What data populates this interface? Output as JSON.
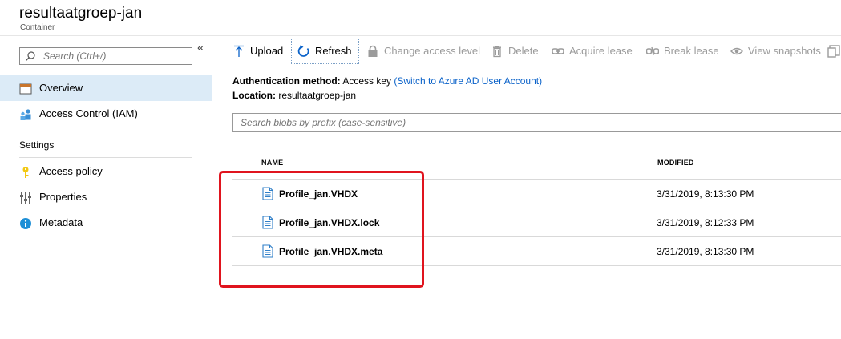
{
  "header": {
    "title": "resultaatgroep-jan",
    "subtitle": "Container"
  },
  "sidebar": {
    "search_placeholder": "Search (Ctrl+/)",
    "collapse_glyph": "«",
    "items": [
      {
        "label": "Overview",
        "icon": "container-overview-icon",
        "active": true
      },
      {
        "label": "Access Control (IAM)",
        "icon": "people-icon",
        "active": false
      }
    ],
    "settings_label": "Settings",
    "settings_items": [
      {
        "label": "Access policy",
        "icon": "key-icon"
      },
      {
        "label": "Properties",
        "icon": "sliders-icon"
      },
      {
        "label": "Metadata",
        "icon": "info-icon"
      }
    ]
  },
  "toolbar": {
    "upload": "Upload",
    "refresh": "Refresh",
    "change_access": "Change access level",
    "delete": "Delete",
    "acquire_lease": "Acquire lease",
    "break_lease": "Break lease",
    "view_snapshots": "View snapshots"
  },
  "info": {
    "auth_label": "Authentication method:",
    "auth_value": "Access key",
    "auth_link": "(Switch to Azure AD User Account)",
    "location_label": "Location:",
    "location_value": "resultaatgroep-jan"
  },
  "blob_search_placeholder": "Search blobs by prefix (case-sensitive)",
  "table": {
    "columns": [
      "NAME",
      "MODIFIED"
    ],
    "rows": [
      {
        "name": "Profile_jan.VHDX",
        "modified": "3/31/2019, 8:13:30 PM"
      },
      {
        "name": "Profile_jan.VHDX.lock",
        "modified": "3/31/2019, 8:12:33 PM"
      },
      {
        "name": "Profile_jan.VHDX.meta",
        "modified": "3/31/2019, 8:13:30 PM"
      }
    ]
  },
  "colors": {
    "accent": "#0a62c9",
    "active_nav": "#dcebf7",
    "highlight_border": "#e0141e",
    "disabled_text": "#9b9b9b"
  }
}
